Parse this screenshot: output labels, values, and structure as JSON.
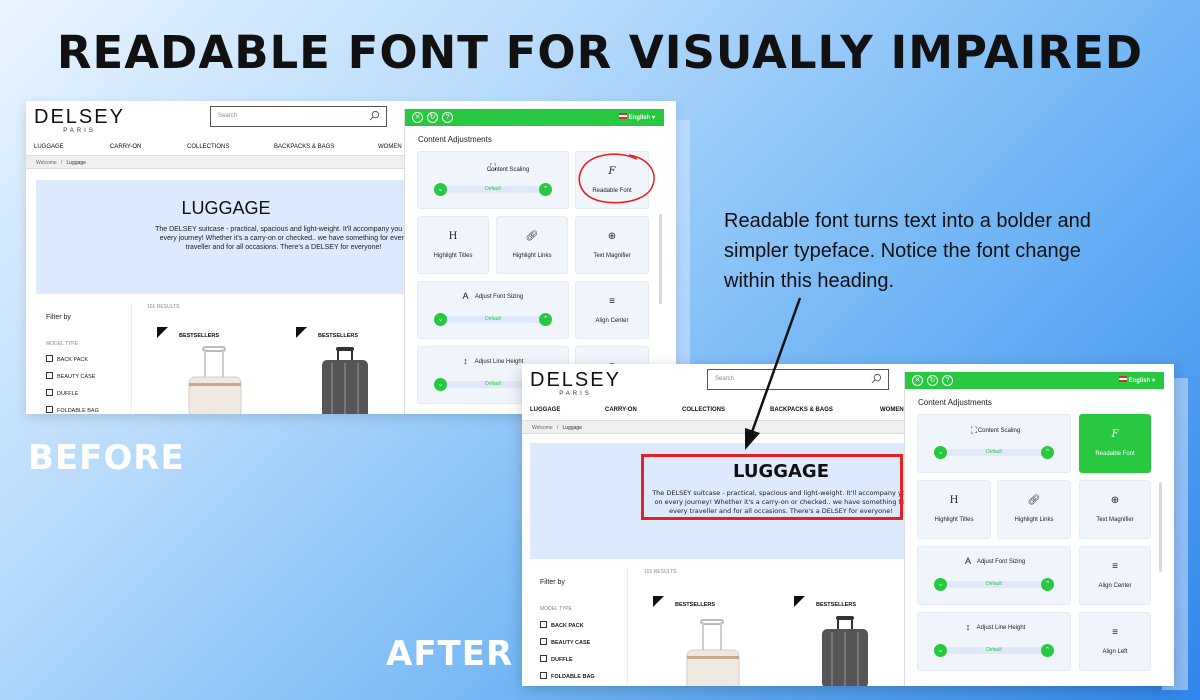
{
  "page": {
    "title": "READABLE FONT FOR VISUALLY IMPAIRED",
    "before_label": "BEFORE",
    "after_label": "AFTER",
    "annotation": "Readable font turns text into a bolder and simpler typeface. Notice the font change within this heading."
  },
  "site": {
    "brand": "DELSEY",
    "brand_sub": "PARIS",
    "search_placeholder": "Search",
    "nav": [
      "LUGGAGE",
      "CARRY-ON",
      "COLLECTIONS",
      "BACKPACKS & BAGS",
      "WOMEN"
    ],
    "breadcrumb": {
      "home": "Welcome",
      "sep": "/",
      "current": "Luggage"
    },
    "hero_title": "LUGGAGE",
    "before_hero_text": "The DELSEY suitcase - practical, spacious and light-weight. It'll accompany you on every journey! Whether it's a carry-on or checked.. we have something for every traveller and for all occasions. There's a DELSEY for everyone!",
    "after_hero_text": "The DELSEY suitcase - practical, spacious and light-weight. It'll accompany you on every journey! Whether it's a carry-on or checked.. we have something for every traveller and for all occasions. There's a DELSEY for everyone!",
    "filter_title": "Filter by",
    "model_type_label": "MODEL TYPE",
    "filter_options": [
      "BACK PACK",
      "BEAUTY CASE",
      "DUFFLE",
      "FOLDABLE BAG"
    ],
    "results": "101 RESULTS",
    "products": [
      {
        "tag": "BESTSELLERS"
      },
      {
        "tag": "BESTSELLERS"
      }
    ]
  },
  "widget": {
    "language": "English",
    "heading": "Content Adjustments",
    "default_label": "Default",
    "tiles": {
      "content_scaling": "Content Scaling",
      "readable_font": "Readable Font",
      "highlight_titles": "Highlight Titles",
      "highlight_links": "Highlight Links",
      "text_magnifier": "Text Magnifier",
      "adjust_font_sizing": "Adjust Font Sizing",
      "align_center": "Align Center",
      "adjust_line_height": "Adjust Line Height",
      "align_left": "Align Left"
    },
    "accent": "#28c840"
  }
}
